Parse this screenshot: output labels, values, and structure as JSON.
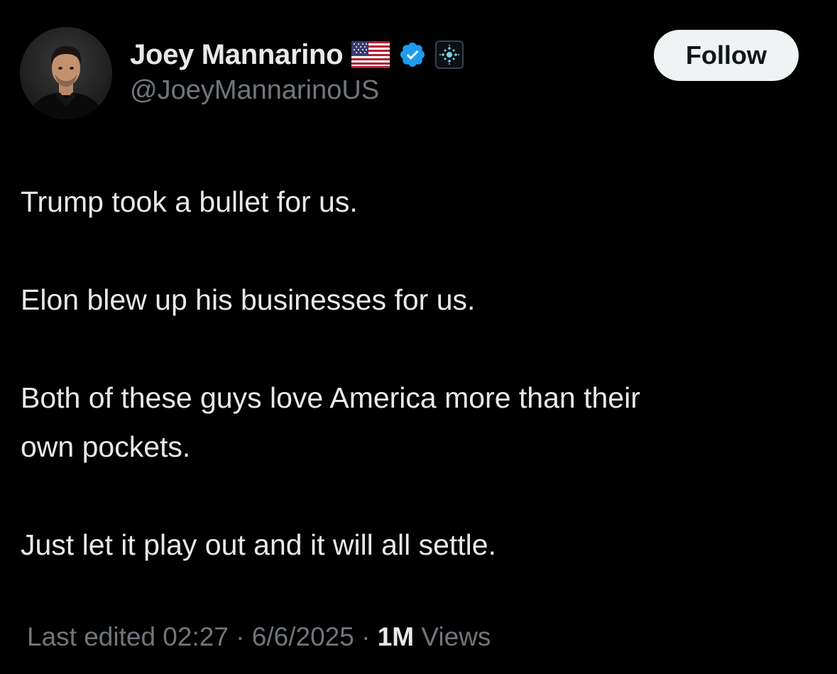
{
  "author": {
    "display_name": "Joey Mannarino",
    "handle": "@JoeyMannarinoUS",
    "badges": [
      "us-flag-icon",
      "verified-badge-icon",
      "affiliate-badge-icon"
    ]
  },
  "follow_button": {
    "label": "Follow"
  },
  "tweet": {
    "paragraphs": [
      "Trump took a bullet for us.",
      "Elon blew up his businesses for us.",
      "Both of these guys love America more than their",
      "own pockets.",
      "Just let it play out and it will all settle."
    ]
  },
  "meta": {
    "edited_label": "Last edited 02:27",
    "separator": " · ",
    "date": "6/6/2025",
    "separator2": " · ",
    "views_count": "1M",
    "views_label": " Views"
  },
  "colors": {
    "background": "#000000",
    "primary_text": "#e7e9ea",
    "secondary_text": "#71767b",
    "verified_blue": "#1d9bf0",
    "follow_bg": "#eff3f4"
  }
}
